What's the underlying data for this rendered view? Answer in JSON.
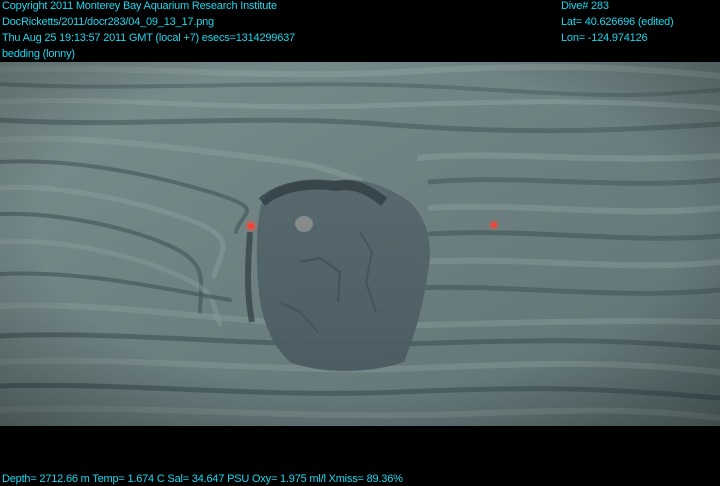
{
  "overlay": {
    "top_left": [
      "Copyright 2011 Monterey Bay Aquarium Research Institute",
      "DocRicketts/2011/docr283/04_09_13_17.png",
      "Thu Aug 25 19:13:57 2011 GMT (local +7)  esecs=1314299637",
      "bedding (lonny)"
    ],
    "top_right": [
      "Dive# 283",
      "Lat= 40.626696 (edited)",
      "Lon= -124.974126"
    ],
    "bottom": "Depth= 2712.66 m  Temp= 1.674 C  Sal= 34.647 PSU  Oxy= 1.975 ml/l  Xmiss= 89.36%"
  },
  "colors": {
    "overlay_text": "#19d9ef",
    "background": "#000000",
    "sediment": "#6f8384",
    "laser_dot": "#ff3a2a"
  },
  "image": {
    "subject": "layered sedimentary bedding on seafloor with a darker slumped block in the center",
    "features": [
      "red-laser-dot-left",
      "red-laser-dot-right"
    ]
  }
}
